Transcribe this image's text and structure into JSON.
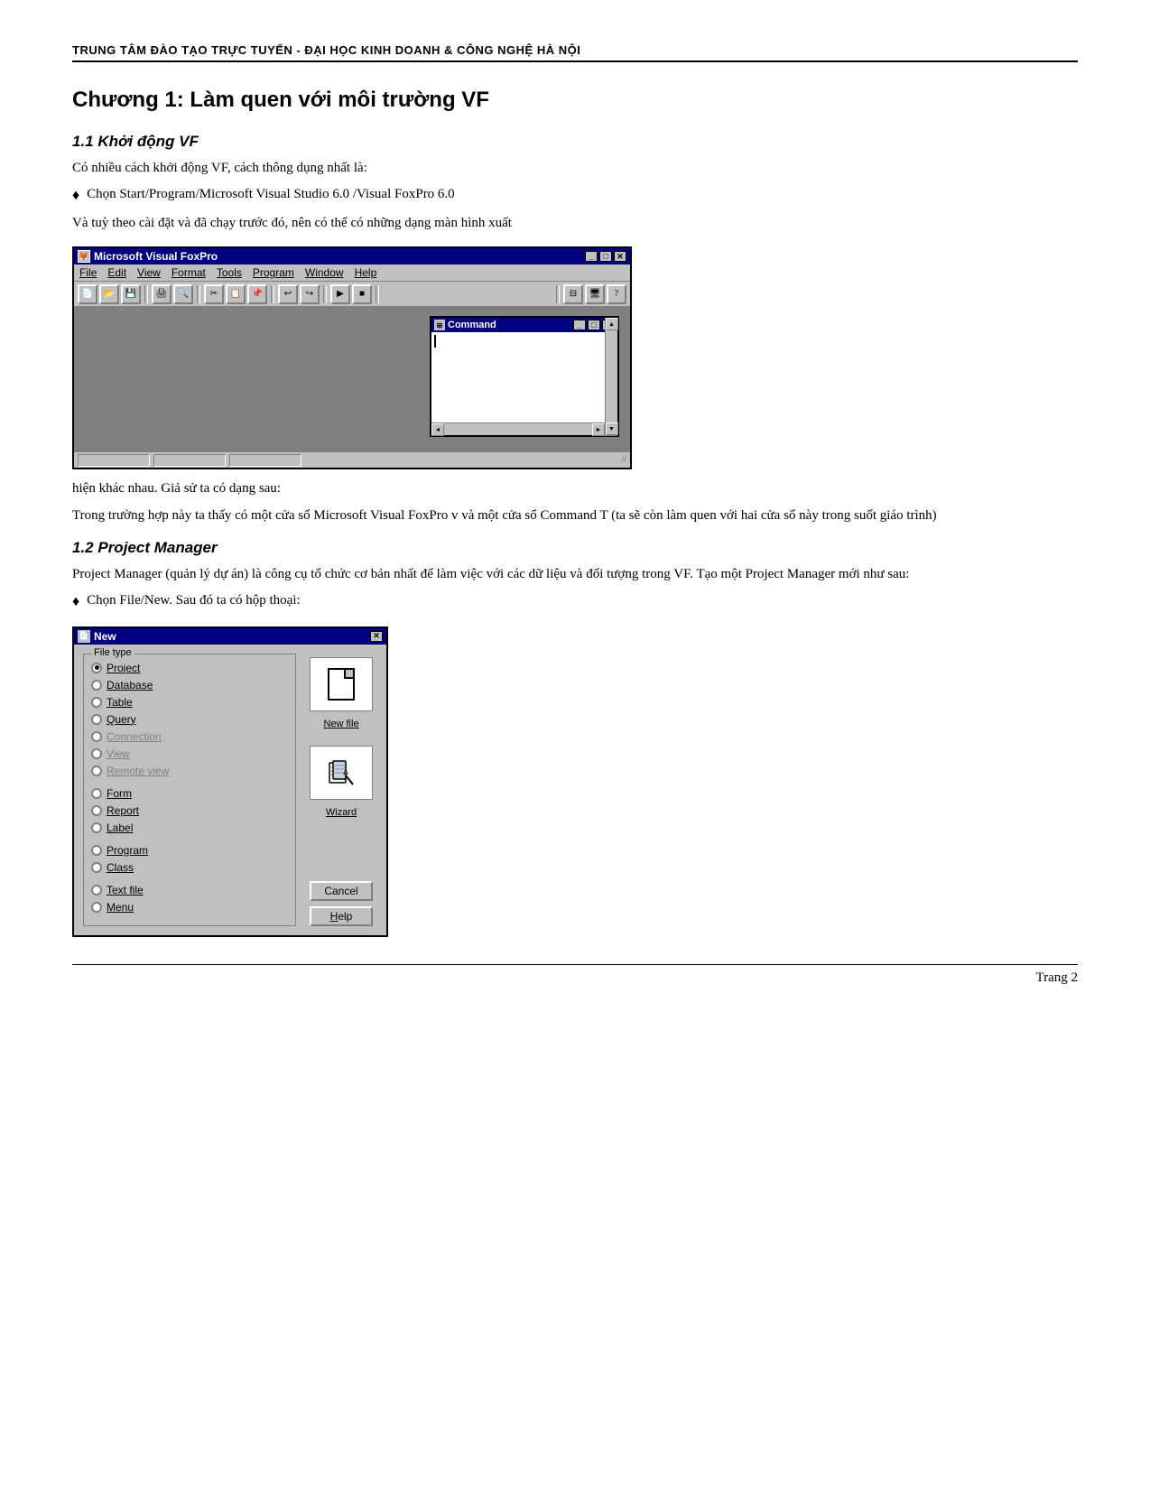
{
  "header": {
    "text": "TRUNG TÂM ĐÀO TẠO TRỰC TUYẾN - ĐẠI HỌC KINH DOANH & CÔNG NGHỆ HÀ NỘI"
  },
  "chapter": {
    "title": "Chương 1: Làm quen với môi trường VF"
  },
  "section1": {
    "title": "1.1 Khởi động VF",
    "para1": "Có nhiều cách khởi động VF, cách thông dụng nhất là:",
    "bullet1": "Chọn Start/Program/Microsoft Visual Studio 6.0 /Visual FoxPro 6.0",
    "para2": "Và tuỳ theo cài đặt và đã chạy trước đó, nên có thể có những dạng màn hình xuất",
    "para3": "hiện khác nhau. Giả sử ta có dạng sau:",
    "para4": "Trong trường hợp này ta thấy có một cửa sổ Microsoft Visual FoxPro v và một cửa sổ Command T (ta sẽ còn làm quen với hai cửa sổ này trong suốt giáo trình)"
  },
  "vfp_window": {
    "title": "Microsoft Visual FoxPro",
    "menu_items": [
      "File",
      "Edit",
      "View",
      "Format",
      "Tools",
      "Program",
      "Window",
      "Help"
    ],
    "command_window": {
      "title": "Command"
    }
  },
  "section2": {
    "title": "1.2 Project Manager",
    "para1": " Project Manager (quản lý dự án) là công cụ tổ chức cơ bản nhất để làm việc với các dữ liệu và đối tượng trong VF. Tạo một  Project Manager mới như sau:",
    "bullet1": "Chọn File/New. Sau đó ta có hộp thoại:"
  },
  "new_dialog": {
    "title": "New",
    "file_type_label": "File type",
    "options": [
      {
        "label": "Project",
        "selected": true,
        "disabled": false
      },
      {
        "label": "Database",
        "selected": false,
        "disabled": false
      },
      {
        "label": "Table",
        "selected": false,
        "disabled": false
      },
      {
        "label": "Query",
        "selected": false,
        "disabled": false
      },
      {
        "label": "Connection",
        "selected": false,
        "disabled": true
      },
      {
        "label": "View",
        "selected": false,
        "disabled": true
      },
      {
        "label": "Remote view",
        "selected": false,
        "disabled": true
      },
      {
        "label": "Form",
        "selected": false,
        "disabled": false
      },
      {
        "label": "Report",
        "selected": false,
        "disabled": false
      },
      {
        "label": "Label",
        "selected": false,
        "disabled": false
      },
      {
        "label": "Program",
        "selected": false,
        "disabled": false
      },
      {
        "label": "Class",
        "selected": false,
        "disabled": false
      },
      {
        "label": "Text file",
        "selected": false,
        "disabled": false
      },
      {
        "label": "Menu",
        "selected": false,
        "disabled": false
      }
    ],
    "new_file_label": "New file",
    "wizard_label": "Wizard",
    "cancel_label": "Cancel",
    "help_label": "Help"
  },
  "footer": {
    "page_label": "Trang 2"
  }
}
